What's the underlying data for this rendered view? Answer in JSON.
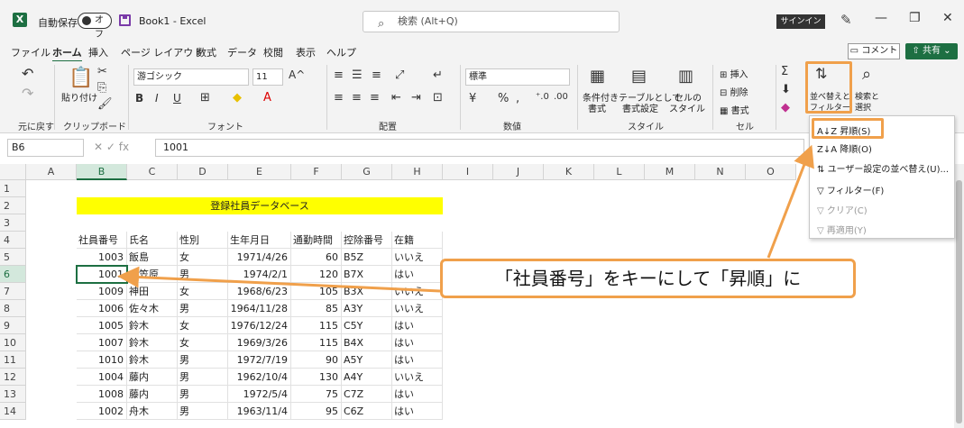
{
  "titlebar": {
    "autosave": "自動保存",
    "toggle": "オフ",
    "doc": "Book1 - Excel",
    "search_placeholder": "検索 (Alt+Q)",
    "signin": "サインイン"
  },
  "menu": [
    "ファイル",
    "ホーム",
    "挿入",
    "ページ レイアウト",
    "数式",
    "データ",
    "校閲",
    "表示",
    "ヘルプ"
  ],
  "comment": "コメント",
  "share": "共有",
  "ribbon": {
    "groups": {
      "undo": "元に戻す",
      "clipboard": "クリップボード",
      "font": "フォント",
      "align": "配置",
      "number": "数値",
      "style": "スタイル",
      "cells": "セル"
    },
    "paste": "貼り付け",
    "font_name": "游ゴシック",
    "font_size": "11",
    "number_format": "標準",
    "cond": "条件付き",
    "cond2": "書式",
    "table": "テーブルとして",
    "table2": "書式設定",
    "cellstyle": "セルの",
    "cellstyle2": "スタイル",
    "insert": "挿入",
    "delete": "削除",
    "format": "書式",
    "sort1": "並べ替えと",
    "sort2": "フィルター",
    "find1": "検索と",
    "find2": "選択"
  },
  "namebox": "B6",
  "formula": "1001",
  "columns": [
    "A",
    "B",
    "C",
    "D",
    "E",
    "F",
    "G",
    "H",
    "I",
    "J",
    "K",
    "L",
    "M",
    "N",
    "O"
  ],
  "rows": [
    "1",
    "2",
    "3",
    "4",
    "5",
    "6",
    "7",
    "8",
    "9",
    "10",
    "11",
    "12",
    "13",
    "14"
  ],
  "sheet_title": "登録社員データベース",
  "headers": [
    "社員番号",
    "氏名",
    "性別",
    "生年月日",
    "通勤時間",
    "控除番号",
    "在籍"
  ],
  "data": [
    [
      "1003",
      "飯島",
      "女",
      "1971/4/26",
      "60",
      "B5Z",
      "いいえ"
    ],
    [
      "1001",
      "小笠原",
      "男",
      "1974/2/1",
      "120",
      "B7X",
      "はい"
    ],
    [
      "1009",
      "神田",
      "女",
      "1968/6/23",
      "105",
      "B3X",
      "いいえ"
    ],
    [
      "1006",
      "佐々木",
      "男",
      "1964/11/28",
      "85",
      "A3Y",
      "いいえ"
    ],
    [
      "1005",
      "鈴木",
      "女",
      "1976/12/24",
      "115",
      "C5Y",
      "はい"
    ],
    [
      "1007",
      "鈴木",
      "女",
      "1969/3/26",
      "115",
      "B4X",
      "はい"
    ],
    [
      "1010",
      "鈴木",
      "男",
      "1972/7/19",
      "90",
      "A5Y",
      "はい"
    ],
    [
      "1004",
      "藤内",
      "男",
      "1962/10/4",
      "130",
      "A4Y",
      "いいえ"
    ],
    [
      "1008",
      "藤内",
      "男",
      "1972/5/4",
      "75",
      "C7Z",
      "はい"
    ],
    [
      "1002",
      "舟木",
      "男",
      "1963/11/4",
      "95",
      "C6Z",
      "はい"
    ]
  ],
  "dropdown": [
    {
      "label": "昇順(S)",
      "enabled": true
    },
    {
      "label": "降順(O)",
      "enabled": true
    },
    {
      "label": "ユーザー設定の並べ替え(U)...",
      "enabled": true
    },
    {
      "label": "フィルター(F)",
      "enabled": true
    },
    {
      "label": "クリア(C)",
      "enabled": false
    },
    {
      "label": "再適用(Y)",
      "enabled": false
    }
  ],
  "callout": "「社員番号」をキーにして「昇順」に",
  "colors": {
    "accent": "#1d6f42",
    "highlight": "#f0a04b",
    "title_fill": "#ffff00"
  }
}
